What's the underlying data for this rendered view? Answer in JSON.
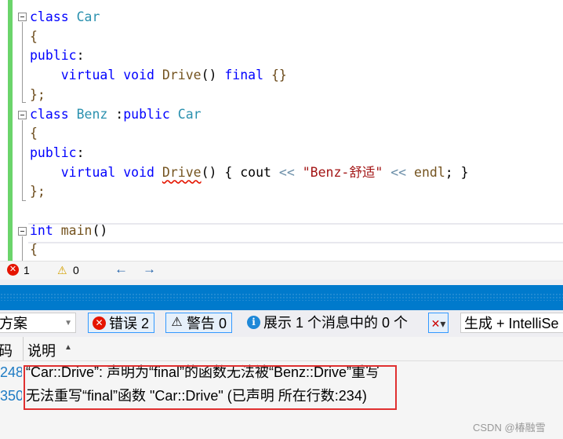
{
  "editor": {
    "lines": [
      [
        {
          "t": "class ",
          "k": "kw"
        },
        {
          "t": "Car",
          "k": "ty"
        }
      ],
      [
        {
          "t": "{",
          "k": "br"
        }
      ],
      [
        {
          "t": "public",
          "k": "kw"
        },
        {
          "t": ":",
          "k": "pl"
        }
      ],
      [
        {
          "t": "    virtual void ",
          "k": "kw"
        },
        {
          "t": "Drive",
          "k": "fn"
        },
        {
          "t": "() ",
          "k": "pl"
        },
        {
          "t": "final ",
          "k": "kw"
        },
        {
          "t": "{}",
          "k": "br"
        }
      ],
      [
        {
          "t": "};",
          "k": "br"
        }
      ],
      [
        {
          "t": "class ",
          "k": "kw"
        },
        {
          "t": "Benz ",
          "k": "ty"
        },
        {
          "t": ":",
          "k": "pl"
        },
        {
          "t": "public ",
          "k": "kw"
        },
        {
          "t": "Car",
          "k": "ty"
        }
      ],
      [
        {
          "t": "{",
          "k": "br"
        }
      ],
      [
        {
          "t": "public",
          "k": "kw"
        },
        {
          "t": ":",
          "k": "pl"
        }
      ],
      [
        {
          "t": "    virtual void ",
          "k": "kw"
        },
        {
          "t": "Drive",
          "k": "fn",
          "err": true
        },
        {
          "t": "() { ",
          "k": "pl"
        },
        {
          "t": "cout ",
          "k": "pl"
        },
        {
          "t": "<< ",
          "k": "op"
        },
        {
          "t": "\"Benz-舒适\"",
          "k": "str"
        },
        {
          "t": " << ",
          "k": "op"
        },
        {
          "t": "endl",
          "k": "fn"
        },
        {
          "t": "; }",
          "k": "pl"
        }
      ],
      [
        {
          "t": "};",
          "k": "br"
        }
      ],
      [],
      [
        {
          "t": "int ",
          "k": "kw"
        },
        {
          "t": "main",
          "k": "fn"
        },
        {
          "t": "()",
          "k": "pl"
        }
      ],
      [
        {
          "t": "{",
          "k": "br"
        }
      ]
    ]
  },
  "status": {
    "errors": "1",
    "warnings": "0"
  },
  "error_list": {
    "scope_dropdown": "方案",
    "errors_button": "错误 2",
    "warnings_button": "警告 0",
    "messages_button": "展示 1 个消息中的 0 个",
    "build_dropdown": "生成 + IntelliSe",
    "columns": {
      "code": "码",
      "description": "说明"
    },
    "rows": [
      {
        "code": "248",
        "description": "“Car::Drive”: 声明为“final”的函数无法被“Benz::Drive”重写"
      },
      {
        "code": "350",
        "description": "无法重写“final”函数 \"Car::Drive\" (已声明 所在行数:234)"
      }
    ]
  },
  "watermark": "CSDN @椿融雪",
  "colors": {
    "accent": "#007acc",
    "error": "#e51400",
    "highlight_box": "#e03030",
    "warning": "#f2c200"
  }
}
